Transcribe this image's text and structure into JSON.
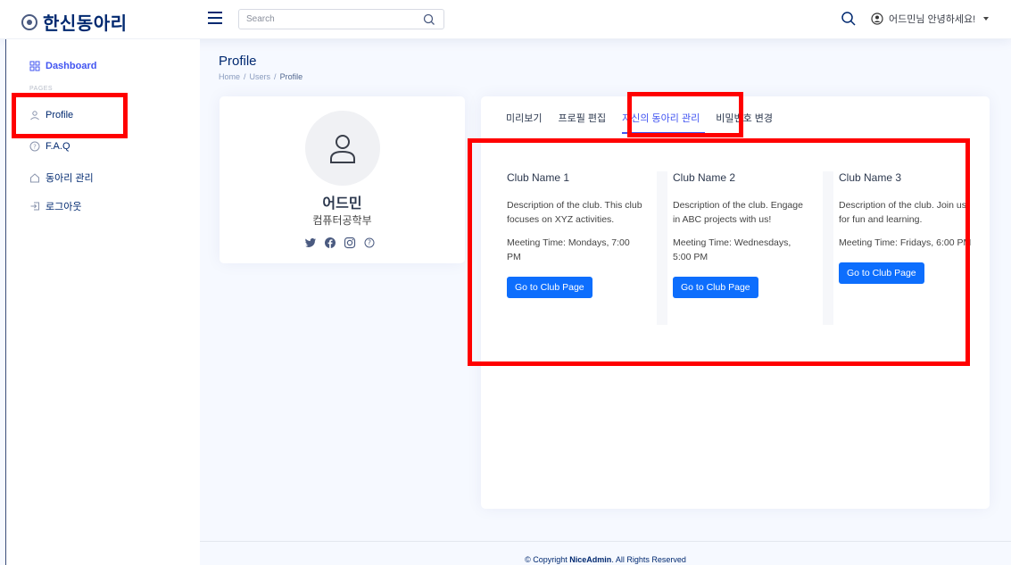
{
  "header": {
    "logo_text": "한신동아리",
    "search_placeholder": "Search",
    "user_greeting": "어드민님 안녕하세요!"
  },
  "sidebar": {
    "items": [
      {
        "label": "Dashboard",
        "icon": "grid-icon"
      },
      {
        "label": "Profile",
        "icon": "person-icon"
      },
      {
        "label": "F.A.Q",
        "icon": "question-circle-icon"
      },
      {
        "label": "동아리 관리",
        "icon": "house-icon"
      },
      {
        "label": "로그아웃",
        "icon": "logout-icon"
      }
    ],
    "heading": "PAGES"
  },
  "page": {
    "title": "Profile",
    "breadcrumb": [
      "Home",
      "/",
      "Users",
      "/",
      "Profile"
    ]
  },
  "profile": {
    "name": "어드민",
    "department": "컴퓨터공학부"
  },
  "tabs": [
    "미리보기",
    "프로필 편집",
    "자신의 동아리 관리",
    "비밀번호 변경"
  ],
  "active_tab": "자신의 동아리 관리",
  "clubs": [
    {
      "name": "Club Name 1",
      "description": "Description of the club. This club focuses on XYZ activities.",
      "meeting": "Meeting Time: Mondays, 7:00 PM",
      "button": "Go to Club Page"
    },
    {
      "name": "Club Name 2",
      "description": "Description of the club. Engage in ABC projects with us!",
      "meeting": "Meeting Time: Wednesdays, 5:00 PM",
      "button": "Go to Club Page"
    },
    {
      "name": "Club Name 3",
      "description": "Description of the club. Join us for fun and learning.",
      "meeting": "Meeting Time: Fridays, 6:00 PM",
      "button": "Go to Club Page"
    }
  ],
  "footer": {
    "prefix": "© Copyright ",
    "brand": "NiceAdmin",
    "suffix": ". All Rights Reserved"
  },
  "colors": {
    "accent": "#4154f1",
    "brand": "#012970",
    "button": "#0d6efd",
    "highlight": "#ff0000"
  }
}
